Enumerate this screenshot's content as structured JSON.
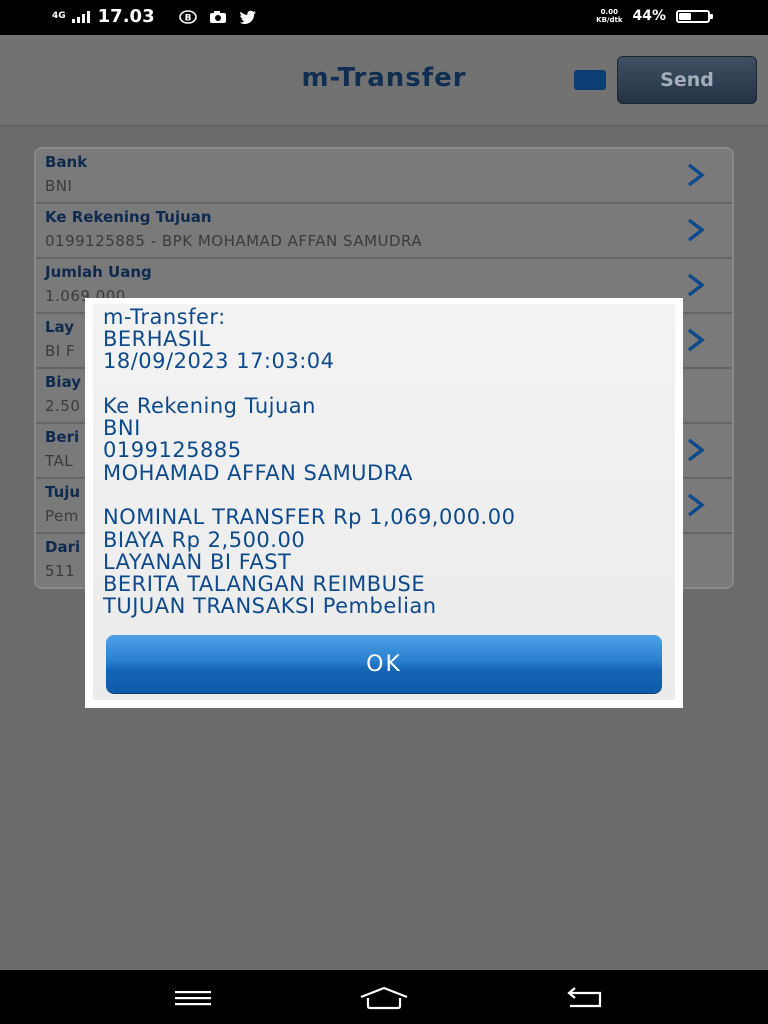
{
  "status_bar": {
    "network": "4G",
    "time": "17.03",
    "icons": [
      "b-chat-icon",
      "camera-icon",
      "twitter-icon"
    ],
    "speed_value": "0.00",
    "speed_unit": "KB/dtk",
    "battery_percent": "44%",
    "battery_level": 0.44
  },
  "app": {
    "title": "m-Transfer",
    "send_label": "Send",
    "rows": [
      {
        "label": "Bank",
        "value": "BNI"
      },
      {
        "label": "Ke Rekening Tujuan",
        "value": "0199125885 - BPK MOHAMAD AFFAN SAMUDRA"
      },
      {
        "label": "Jumlah Uang",
        "value": "1.069.000"
      },
      {
        "label": "Lay",
        "value": "BI F"
      },
      {
        "label": "Biay",
        "value": "2.50"
      },
      {
        "label": "Beri",
        "value": "TAL"
      },
      {
        "label": "Tuju",
        "value": "Pem"
      },
      {
        "label": "Dari",
        "value": "511"
      }
    ]
  },
  "dialog": {
    "lines": [
      "m-Transfer:",
      "BERHASIL",
      "18/09/2023 17:03:04",
      "",
      "Ke Rekening Tujuan",
      "BNI",
      "0199125885",
      "MOHAMAD AFFAN SAMUDRA",
      "",
      "NOMINAL TRANSFER Rp 1,069,000.00",
      "BIAYA Rp 2,500.00",
      "LAYANAN BI FAST",
      "BERITA TALANGAN REIMBUSE",
      "TUJUAN TRANSAKSI Pembelian"
    ],
    "ok_label": "OK"
  },
  "nav_bar": {
    "icons": [
      "menu-icon",
      "home-icon",
      "back-icon"
    ]
  },
  "colors": {
    "title": "#0f2e52",
    "dialog_text": "#0d4a8c",
    "ok_button": "#1565b7",
    "chevron": "#0d4a8c"
  }
}
